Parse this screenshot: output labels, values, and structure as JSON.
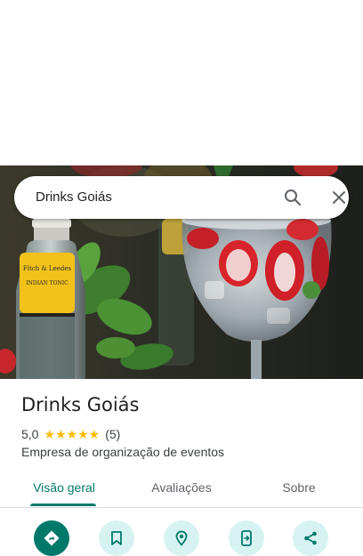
{
  "search": {
    "query": "Drinks Goiás"
  },
  "place": {
    "name": "Drinks Goiás",
    "rating": "5,0",
    "stars": "★★★★★",
    "review_count": "(5)",
    "category": "Empresa de organização de eventos"
  },
  "tabs": [
    {
      "label": "Visão geral"
    },
    {
      "label": "Avaliações"
    },
    {
      "label": "Sobre"
    }
  ],
  "photo": {
    "bottle_label": "Fitch & Leedes INDIAN TONIC"
  },
  "colors": {
    "accent": "#00796b",
    "chip": "#d6f3f1",
    "star": "#fbbc04"
  },
  "icons": [
    "search-icon",
    "close-icon",
    "directions-icon",
    "bookmark-icon",
    "pin-icon",
    "send-to-phone-icon",
    "share-icon"
  ]
}
